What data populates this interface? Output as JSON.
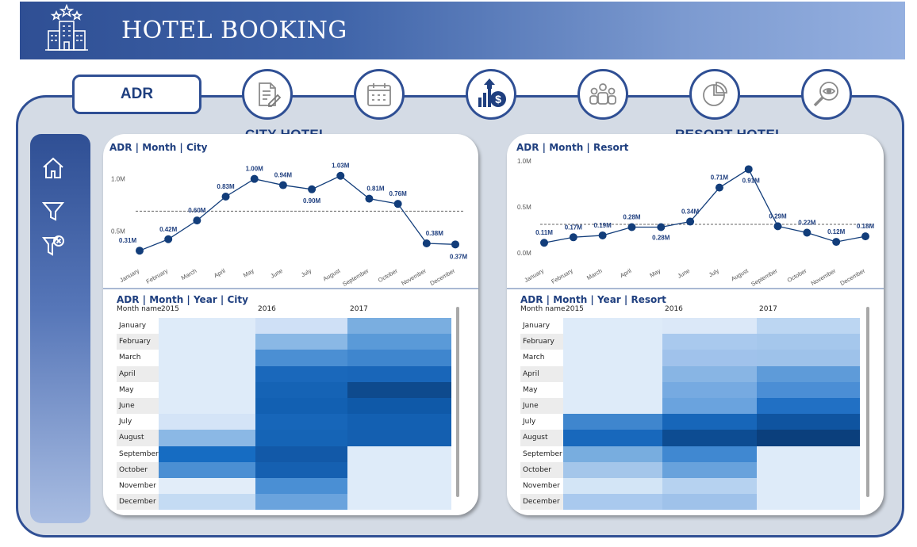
{
  "header": {
    "title": "HOTEL BOOKING"
  },
  "nav": {
    "active_tab": "ADR",
    "icons": [
      "document-edit-icon",
      "calendar-icon",
      "revenue-chart-icon",
      "customers-icon",
      "pie-chart-icon",
      "search-eye-icon"
    ]
  },
  "sidebar": {
    "icons": [
      "home-icon",
      "filter-icon",
      "clear-filter-icon"
    ]
  },
  "city": {
    "section_title": "CITY HOTEL",
    "line_title": "ADR | Month | City",
    "heat_title": "ADR | Month | Year | City"
  },
  "resort": {
    "section_title": "RESORT HOTEL",
    "line_title": "ADR | Month | Resort",
    "heat_title": "ADR | Month | Year | Resort"
  },
  "heatmap_headers": {
    "month_col": "Month name",
    "years": [
      "2015",
      "2016",
      "2017"
    ]
  },
  "months": [
    "January",
    "February",
    "March",
    "April",
    "May",
    "June",
    "July",
    "August",
    "September",
    "October",
    "November",
    "December"
  ],
  "chart_data": [
    {
      "type": "line",
      "title": "ADR | Month | City",
      "categories": [
        "January",
        "February",
        "March",
        "April",
        "May",
        "June",
        "July",
        "August",
        "September",
        "October",
        "November",
        "December"
      ],
      "values": [
        0.31,
        0.42,
        0.6,
        0.83,
        1.0,
        0.94,
        0.9,
        1.03,
        0.81,
        0.76,
        0.38,
        0.37
      ],
      "labels": [
        "0.31M",
        "0.42M",
        "0.60M",
        "0.83M",
        "1.00M",
        "0.94M",
        "0.90M",
        "1.03M",
        "0.81M",
        "0.76M",
        "0.38M",
        "0.37M"
      ],
      "y_ticks": [
        "1.0M",
        "0.5M"
      ],
      "average_line": 0.69,
      "ylim": [
        0.22,
        1.15
      ],
      "color": "#123d7a"
    },
    {
      "type": "line",
      "title": "ADR | Month | Resort",
      "categories": [
        "January",
        "February",
        "March",
        "April",
        "May",
        "June",
        "July",
        "August",
        "September",
        "October",
        "November",
        "December"
      ],
      "values": [
        0.11,
        0.17,
        0.19,
        0.28,
        0.28,
        0.34,
        0.71,
        0.91,
        0.29,
        0.22,
        0.12,
        0.18
      ],
      "labels": [
        "0.11M",
        "0.17M",
        "0.19M",
        "0.28M",
        "0.28M",
        "0.34M",
        "0.71M",
        "0.91M",
        "0.29M",
        "0.22M",
        "0.12M",
        "0.18M"
      ],
      "y_ticks": [
        "1.0M",
        "0.5M",
        "0.0M"
      ],
      "average_line": 0.31,
      "ylim": [
        0.0,
        1.0
      ],
      "color": "#123d7a"
    },
    {
      "type": "heatmap",
      "title": "ADR | Month | Year | City",
      "x": [
        "2015",
        "2016",
        "2017"
      ],
      "y": [
        "January",
        "February",
        "March",
        "April",
        "May",
        "June",
        "July",
        "August",
        "September",
        "October",
        "November",
        "December"
      ],
      "colors": [
        [
          "#deebf9",
          "#cfe0f6",
          "#7aaee0"
        ],
        [
          "#deebf9",
          "#8ab8e5",
          "#5a9ad8"
        ],
        [
          "#deebf9",
          "#4b8fd3",
          "#3f86ce"
        ],
        [
          "#deebf9",
          "#1a68bb",
          "#1966b9"
        ],
        [
          "#deebf9",
          "#1563b5",
          "#0e4a8d"
        ],
        [
          "#deebf9",
          "#1260b2",
          "#0f59a8"
        ],
        [
          "#d4e4f7",
          "#1766b9",
          "#1360b2"
        ],
        [
          "#8bb8e5",
          "#1564b6",
          "#145fb0"
        ],
        [
          "#166cc2",
          "#1259a8",
          "#ffffff"
        ],
        [
          "#4b8fd3",
          "#1560b1",
          "#ffffff"
        ],
        [
          "#e2edf9",
          "#4a8fd4",
          "#ffffff"
        ],
        [
          "#c4dbf3",
          "#6aa3dd",
          "#ffffff"
        ]
      ]
    },
    {
      "type": "heatmap",
      "title": "ADR | Month | Year | Resort",
      "x": [
        "2015",
        "2016",
        "2017"
      ],
      "y": [
        "January",
        "February",
        "March",
        "April",
        "May",
        "June",
        "July",
        "August",
        "September",
        "October",
        "November",
        "December"
      ],
      "colors": [
        [
          "#deebf9",
          "#dbe8f8",
          "#bcd6f2"
        ],
        [
          "#deebf9",
          "#a9c9ee",
          "#a5c7ec"
        ],
        [
          "#deebf9",
          "#a0c2eb",
          "#9ec2ea"
        ],
        [
          "#deebf9",
          "#88b5e4",
          "#5e9bd9"
        ],
        [
          "#deebf9",
          "#76aae1",
          "#4b8ed5"
        ],
        [
          "#deebf9",
          "#6aa3de",
          "#2170c4"
        ],
        [
          "#3f86ce",
          "#1766b9",
          "#0f54a0"
        ],
        [
          "#1868bc",
          "#0d4c92",
          "#0b3f7c"
        ],
        [
          "#78addf",
          "#4088d1",
          "#ffffff"
        ],
        [
          "#a4c6ea",
          "#68a2dc",
          "#ffffff"
        ],
        [
          "#d3e5f6",
          "#b6d2f0",
          "#ffffff"
        ],
        [
          "#a9c9ee",
          "#9fc2ea",
          "#ffffff"
        ]
      ]
    }
  ]
}
